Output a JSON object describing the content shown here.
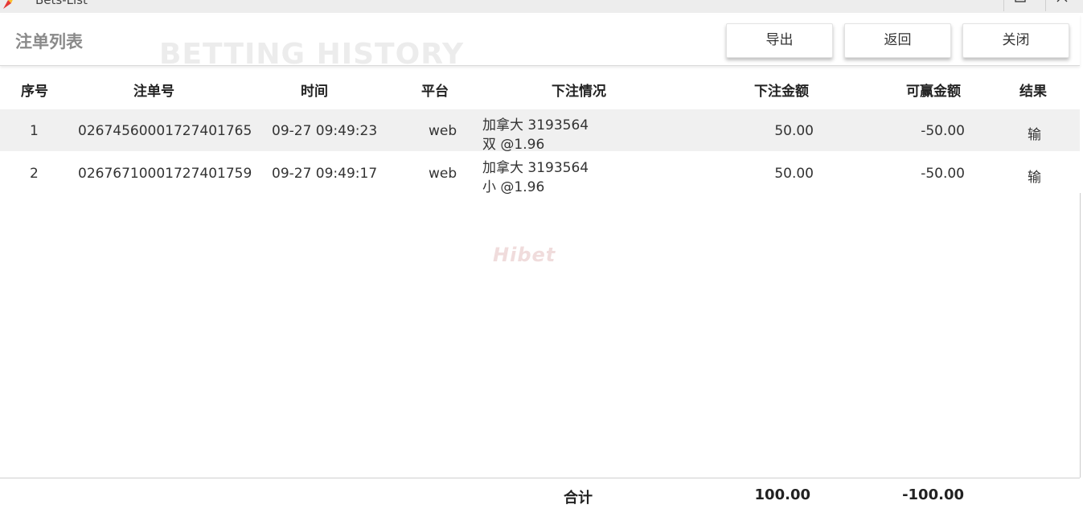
{
  "window": {
    "title": "Bets-List"
  },
  "header": {
    "title": "注单列表",
    "watermark": "BETTING HISTORY",
    "buttons": {
      "export": "导出",
      "back": "返回",
      "close": "关闭"
    }
  },
  "table": {
    "columns": [
      "序号",
      "注单号",
      "时间",
      "平台",
      "下注情况",
      "下注金额",
      "可赢金额",
      "结果"
    ],
    "rows": [
      {
        "index": "1",
        "bet_id": "02674560001727401765",
        "time": "09-27 09:49:23",
        "platform": "web",
        "detail_line1": "加拿大 3193564",
        "detail_line2": "双 @1.96",
        "stake": "50.00",
        "win": "-50.00",
        "result": "输"
      },
      {
        "index": "2",
        "bet_id": "02676710001727401759",
        "time": "09-27 09:49:17",
        "platform": "web",
        "detail_line1": "加拿大 3193564",
        "detail_line2": "小 @1.96",
        "stake": "50.00",
        "win": "-50.00",
        "result": "输"
      }
    ]
  },
  "center_watermark": "Hibet",
  "footer": {
    "label": "合计",
    "stake_total": "100.00",
    "win_total": "-100.00"
  },
  "colors": {
    "row_alt": "#f0f0f0",
    "title_gray": "#8a8a8a",
    "watermark": "#ececec"
  }
}
